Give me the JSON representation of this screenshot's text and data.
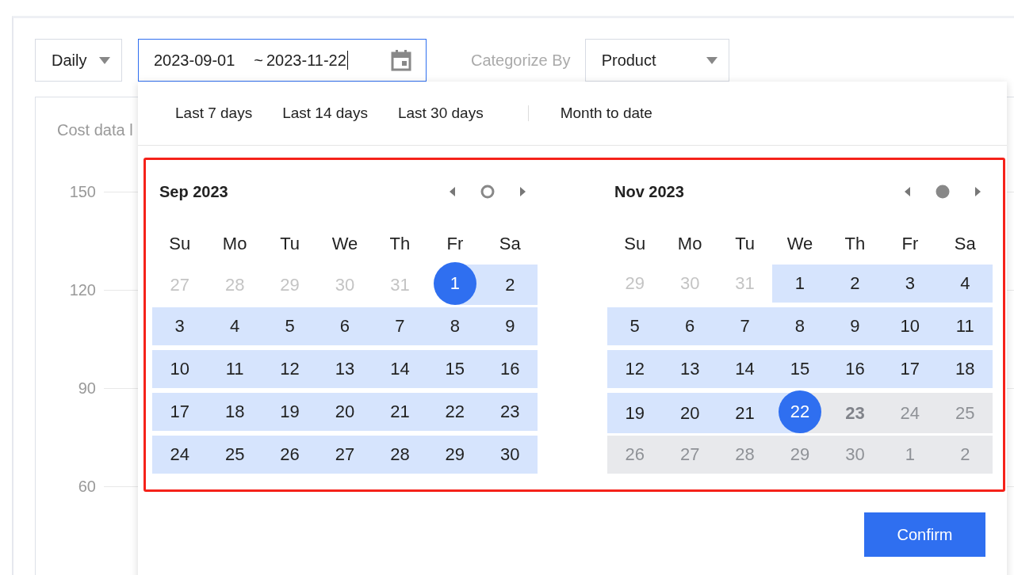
{
  "toolbar": {
    "granularity": {
      "value": "Daily"
    },
    "date_range": {
      "start": "2023-09-01",
      "separator": "~",
      "end": "2023-11-22",
      "focused": true
    },
    "categorize_label": "Categorize By",
    "categorize": {
      "value": "Product"
    }
  },
  "chart_card": {
    "title": "Cost data l",
    "y_labels": [
      "150",
      "120",
      "90",
      "60"
    ]
  },
  "picker": {
    "shortcut_groups": [
      [
        "Last 7 days",
        "Last 14 days",
        "Last 30 days"
      ],
      [
        "Month to date"
      ]
    ],
    "calendars": [
      {
        "title": "Sep 2023",
        "current_on": false,
        "weekdays": [
          "Su",
          "Mo",
          "Tu",
          "We",
          "Th",
          "Fr",
          "Sa"
        ],
        "weeks": [
          [
            {
              "label": "27",
              "kind": "other"
            },
            {
              "label": "28",
              "kind": "other"
            },
            {
              "label": "29",
              "kind": "other"
            },
            {
              "label": "30",
              "kind": "other"
            },
            {
              "label": "31",
              "kind": "other"
            },
            {
              "label": "1",
              "kind": "range_start"
            },
            {
              "label": "2",
              "kind": "in_range"
            }
          ],
          [
            {
              "label": "3",
              "kind": "in_range"
            },
            {
              "label": "4",
              "kind": "in_range"
            },
            {
              "label": "5",
              "kind": "in_range"
            },
            {
              "label": "6",
              "kind": "in_range"
            },
            {
              "label": "7",
              "kind": "in_range"
            },
            {
              "label": "8",
              "kind": "in_range"
            },
            {
              "label": "9",
              "kind": "in_range"
            }
          ],
          [
            {
              "label": "10",
              "kind": "in_range"
            },
            {
              "label": "11",
              "kind": "in_range"
            },
            {
              "label": "12",
              "kind": "in_range"
            },
            {
              "label": "13",
              "kind": "in_range"
            },
            {
              "label": "14",
              "kind": "in_range"
            },
            {
              "label": "15",
              "kind": "in_range"
            },
            {
              "label": "16",
              "kind": "in_range"
            }
          ],
          [
            {
              "label": "17",
              "kind": "in_range"
            },
            {
              "label": "18",
              "kind": "in_range"
            },
            {
              "label": "19",
              "kind": "in_range"
            },
            {
              "label": "20",
              "kind": "in_range"
            },
            {
              "label": "21",
              "kind": "in_range"
            },
            {
              "label": "22",
              "kind": "in_range"
            },
            {
              "label": "23",
              "kind": "in_range"
            }
          ],
          [
            {
              "label": "24",
              "kind": "in_range"
            },
            {
              "label": "25",
              "kind": "in_range"
            },
            {
              "label": "26",
              "kind": "in_range"
            },
            {
              "label": "27",
              "kind": "in_range"
            },
            {
              "label": "28",
              "kind": "in_range"
            },
            {
              "label": "29",
              "kind": "in_range"
            },
            {
              "label": "30",
              "kind": "in_range"
            }
          ]
        ]
      },
      {
        "title": "Nov 2023",
        "current_on": true,
        "weekdays": [
          "Su",
          "Mo",
          "Tu",
          "We",
          "Th",
          "Fr",
          "Sa"
        ],
        "weeks": [
          [
            {
              "label": "29",
              "kind": "other"
            },
            {
              "label": "30",
              "kind": "other"
            },
            {
              "label": "31",
              "kind": "other"
            },
            {
              "label": "1",
              "kind": "in_range"
            },
            {
              "label": "2",
              "kind": "in_range"
            },
            {
              "label": "3",
              "kind": "in_range"
            },
            {
              "label": "4",
              "kind": "in_range"
            }
          ],
          [
            {
              "label": "5",
              "kind": "in_range"
            },
            {
              "label": "6",
              "kind": "in_range"
            },
            {
              "label": "7",
              "kind": "in_range"
            },
            {
              "label": "8",
              "kind": "in_range"
            },
            {
              "label": "9",
              "kind": "in_range"
            },
            {
              "label": "10",
              "kind": "in_range"
            },
            {
              "label": "11",
              "kind": "in_range"
            }
          ],
          [
            {
              "label": "12",
              "kind": "in_range"
            },
            {
              "label": "13",
              "kind": "in_range"
            },
            {
              "label": "14",
              "kind": "in_range"
            },
            {
              "label": "15",
              "kind": "in_range"
            },
            {
              "label": "16",
              "kind": "in_range"
            },
            {
              "label": "17",
              "kind": "in_range"
            },
            {
              "label": "18",
              "kind": "in_range"
            }
          ],
          [
            {
              "label": "19",
              "kind": "in_range"
            },
            {
              "label": "20",
              "kind": "in_range"
            },
            {
              "label": "21",
              "kind": "in_range"
            },
            {
              "label": "22",
              "kind": "range_end"
            },
            {
              "label": "23",
              "kind": "today_disabled"
            },
            {
              "label": "24",
              "kind": "disabled"
            },
            {
              "label": "25",
              "kind": "disabled"
            }
          ],
          [
            {
              "label": "26",
              "kind": "disabled"
            },
            {
              "label": "27",
              "kind": "disabled"
            },
            {
              "label": "28",
              "kind": "disabled"
            },
            {
              "label": "29",
              "kind": "disabled"
            },
            {
              "label": "30",
              "kind": "disabled"
            },
            {
              "label": "1",
              "kind": "disabled"
            },
            {
              "label": "2",
              "kind": "disabled"
            }
          ]
        ]
      }
    ],
    "confirm": "Confirm"
  }
}
